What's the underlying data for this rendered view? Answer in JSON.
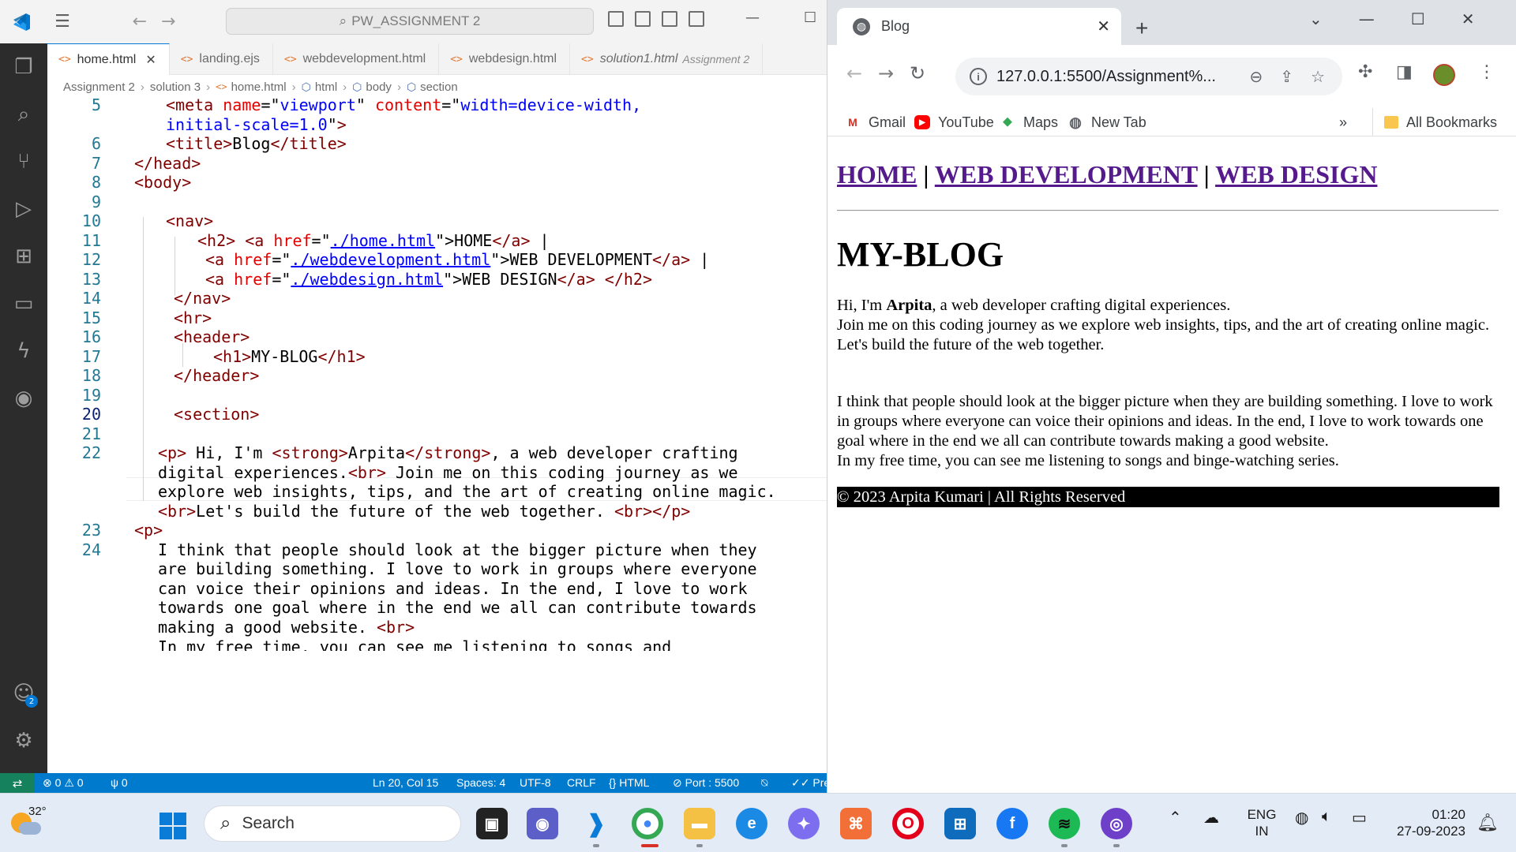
{
  "vscode": {
    "search_text": "PW_ASSIGNMENT 2",
    "tabs": [
      {
        "label": "home.html",
        "close": "✕"
      },
      {
        "label": "landing.ejs"
      },
      {
        "label": "webdevelopment.html"
      },
      {
        "label": "webdesign.html"
      },
      {
        "label": "solution1.html",
        "description": "Assignment 2"
      }
    ],
    "breadcrumb": [
      "Assignment 2",
      "solution 3",
      "home.html",
      "html",
      "body",
      "section"
    ],
    "line_numbers": [
      "5",
      "6",
      "7",
      "8",
      "9",
      "10",
      "11",
      "12",
      "13",
      "14",
      "15",
      "16",
      "17",
      "18",
      "19",
      "20",
      "21",
      "22",
      "23",
      "24"
    ],
    "code": {
      "l5a_tag": "<meta",
      "l5a_attr1": "name",
      "l5a_eq1": "=\"",
      "l5a_val1": "viewport",
      "l5a_q1": "\"",
      "l5a_attr2": "content",
      "l5a_eq2": "=\"",
      "l5a_val2": "width=device-width,",
      "l5b_val": "initial-scale=1.0",
      "l5b_q": "\"",
      "l5b_close": ">",
      "l6_open": "<title>",
      "l6_text": "Blog",
      "l6_close": "</title>",
      "l7": "</head>",
      "l8": "<body>",
      "l10": "<nav>",
      "l11_h2": "<h2>",
      "l11_a": "<a",
      "l11_href": "href",
      "l11_eq": "=\"",
      "l11_url": "./home.html",
      "l11_q": "\">",
      "l11_text": "HOME",
      "l11_close": "</a>",
      "l11_pipe": " |",
      "l12_a": "<a",
      "l12_href": "href",
      "l12_eq": "=\"",
      "l12_url": "./webdevelopment.html",
      "l12_q": "\">",
      "l12_text": "WEB DEVELOPMENT",
      "l12_close": "</a>",
      "l12_pipe": " |",
      "l13_a": "<a",
      "l13_href": "href",
      "l13_eq": "=\"",
      "l13_url": "./webdesign.html",
      "l13_q": "\">",
      "l13_text": "WEB DESIGN",
      "l13_close": "</a> </h2>",
      "l14": "</nav>",
      "l15": "<hr>",
      "l16": "<header>",
      "l17_open": "<h1>",
      "l17_text": "MY-BLOG",
      "l17_close": "</h1>",
      "l18": "</header>",
      "l20": "<section>",
      "l22a_p": "<p>",
      "l22a_t1": " Hi, I'm ",
      "l22a_strong": "<strong>",
      "l22a_name": "Arpita",
      "l22a_strong_close": "</strong>",
      "l22a_t2": ", a web developer crafting",
      "l22b_t": "digital experiences.",
      "l22b_br": "<br>",
      "l22b_t2": " Join me on this coding journey as we",
      "l22c": "explore web insights, tips, and the art of creating online magic.",
      "l22d_br": "<br>",
      "l22d_t": "Let's build the future of the web together. ",
      "l22d_end": "<br></p>",
      "l23": "<p>",
      "l24a": "I think that people should look at the bigger picture when they",
      "l24b": "are building something. I love to work in groups where everyone",
      "l24c": "can voice their opinions and ideas. In the end, I love to work",
      "l24d": "towards one goal where in the end we all can contribute towards",
      "l24e_t": "making a good website. ",
      "l24e_br": "<br>",
      "l25": "In my free time, you can see me listening to songs and"
    },
    "status": {
      "errors": "0",
      "warnings": "0",
      "ports": "0",
      "position": "Ln 20, Col 15",
      "spaces": "Spaces: 4",
      "encoding": "UTF-8",
      "eol": "CRLF",
      "language": "HTML",
      "port": "Port : 5500",
      "prettier": "Pre"
    }
  },
  "chrome": {
    "tab_title": "Blog",
    "url": "127.0.0.1:5500/Assignment%...",
    "bookmarks": [
      "Gmail",
      "YouTube",
      "Maps",
      "New Tab"
    ],
    "bookmarks_more": "»",
    "all_bookmarks": "All Bookmarks"
  },
  "page": {
    "nav": {
      "home": "HOME",
      "sep1": " | ",
      "webdev": "WEB DEVELOPMENT",
      "sep2": " | ",
      "webdesign": "WEB DESIGN"
    },
    "h1": "MY-BLOG",
    "p1_t1": "Hi, I'm ",
    "p1_name": "Arpita",
    "p1_t2": ", a web developer crafting digital experiences.",
    "p1_l2": "Join me on this coding journey as we explore web insights, tips, and the art of creating online magic.",
    "p1_l3": "Let's build the future of the web together.",
    "p2": "I think that people should look at the bigger picture when they are building something. I love to work in groups where everyone can voice their opinions and ideas. In the end, I love to work towards one goal where in the end we all can contribute towards making a good website.",
    "p2_l2": "In my free time, you can see me listening to songs and binge-watching series.",
    "footer": "© 2023 Arpita Kumari | All Rights Reserved"
  },
  "taskbar": {
    "temperature": "32°",
    "search": "Search",
    "lang_line1": "ENG",
    "lang_line2": "IN",
    "time": "01:20",
    "date": "27-09-2023"
  }
}
